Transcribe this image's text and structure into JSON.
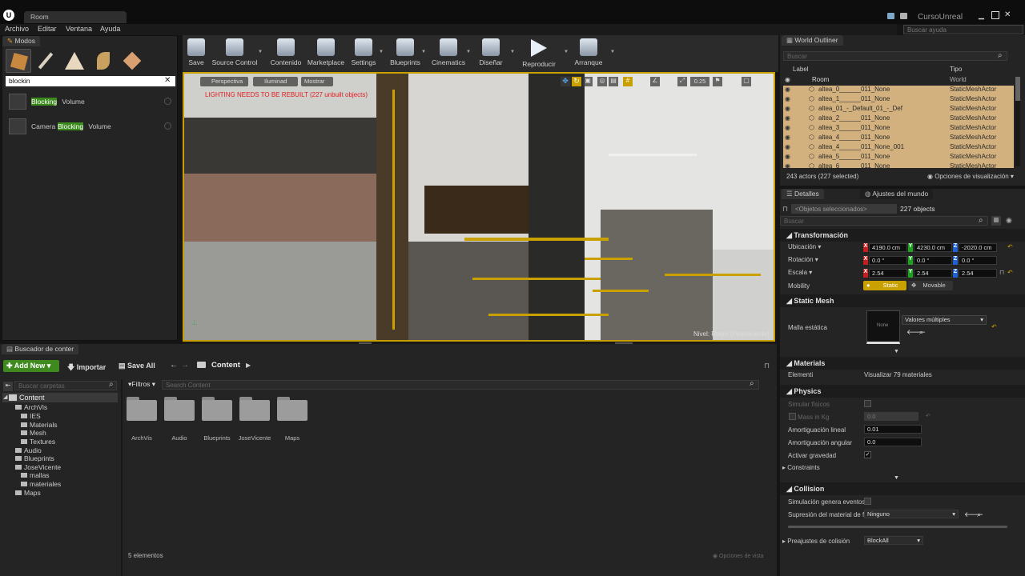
{
  "titlebar": {
    "tab_title": "Room",
    "project": "CursoUnreal",
    "help_search_placeholder": "Buscar ayuda"
  },
  "menu": {
    "items": [
      "Archivo",
      "Editar",
      "Ventana",
      "Ayuda"
    ]
  },
  "modes": {
    "tab_label": "Modos",
    "search_value": "blockin",
    "results": [
      {
        "prefix": "",
        "match": "Blocking",
        "suffix": " Volume"
      },
      {
        "prefix": "Camera ",
        "match": "Blocking",
        "suffix": " Volume"
      }
    ]
  },
  "toolbar": {
    "buttons": [
      "Save",
      "Source Control",
      "Contenido",
      "Marketplace",
      "Settings",
      "Blueprints",
      "Cinematics",
      "Diseñar",
      "Reproducir",
      "Arranque"
    ]
  },
  "viewport": {
    "perspective": "Perspectiva",
    "lighting": "Iluminad",
    "show": "Mostrar",
    "warning": "LIGHTING NEEDS TO BE REBUILT (227 unbuilt objects)",
    "level_label": "Nivel: Room (Permanente)",
    "grid_size": "0.25"
  },
  "outliner": {
    "tab_label": "World Outliner",
    "search_placeholder": "Buscar",
    "col_label": "Label",
    "col_type": "Tipo",
    "rows": [
      {
        "label": "Room",
        "type": "World"
      },
      {
        "label": "altea_0______011_None",
        "type": "StaticMeshActor"
      },
      {
        "label": "altea_1______011_None",
        "type": "StaticMeshActor"
      },
      {
        "label": "altea_01_-_Default_01_-_Def",
        "type": "StaticMeshActor"
      },
      {
        "label": "altea_2______011_None",
        "type": "StaticMeshActor"
      },
      {
        "label": "altea_3______011_None",
        "type": "StaticMeshActor"
      },
      {
        "label": "altea_4______011_None",
        "type": "StaticMeshActor"
      },
      {
        "label": "altea_4______011_None_001",
        "type": "StaticMeshActor"
      },
      {
        "label": "altea_5______011_None",
        "type": "StaticMeshActor"
      },
      {
        "label": "altea_6______011_None",
        "type": "StaticMeshActor"
      }
    ],
    "status": "243 actors (227 selected)",
    "view_options": "Opciones de visualización"
  },
  "details": {
    "tab_details": "Detalles",
    "tab_world": "Ajustes del mundo",
    "selected_placeholder": "<Objetos seleccionados>",
    "count": "227 objects",
    "search_placeholder": "Buscar",
    "transform": {
      "header": "Transformación",
      "location_label": "Ubicación",
      "rotation_label": "Rotación",
      "scale_label": "Escala",
      "location": [
        "4190.0 cm",
        "4230.0 cm",
        "-2020.0 cm"
      ],
      "rotation": [
        "0.0 °",
        "0.0 °",
        "0.0 °"
      ],
      "scale": [
        "2.54",
        "2.54",
        "2.54"
      ],
      "mobility_label": "Mobility",
      "mobility_static": "Static",
      "mobility_movable": "Movable"
    },
    "static_mesh": {
      "header": "Static Mesh",
      "label": "Malla estática",
      "thumb": "None",
      "value": "Valores múltiples"
    },
    "materials": {
      "header": "Materials",
      "label": "Elementi",
      "value": "Visualizar 79 materiales"
    },
    "physics": {
      "header": "Physics",
      "simulate": "Simular físicos",
      "mass": "Mass in Kg",
      "mass_value": "0.0",
      "linear_damping": "Amortiguación lineal",
      "linear_value": "0.01",
      "angular_damping": "Amortiguación angular",
      "angular_value": "0.0",
      "gravity": "Activar gravedad",
      "constraints": "Constraints"
    },
    "collision": {
      "header": "Collision",
      "events": "Simulación genera eventos",
      "material_override": "Supresión del material de f",
      "material_value": "Ninguno",
      "presets": "Preajustes de colisión",
      "presets_value": "BlockAll"
    }
  },
  "content_browser": {
    "tab_label": "Buscador de conter",
    "add_new": "Add New",
    "import": "Importar",
    "save_all": "Save All",
    "path": "Content",
    "folder_search_placeholder": "Buscar carpetas",
    "filters": "Filtros",
    "search_placeholder": "Search Content",
    "tree": [
      "Content",
      "ArchVis",
      "IES",
      "Materials",
      "Mesh",
      "Textures",
      "Audio",
      "Blueprints",
      "JoseVicente",
      "mallas",
      "materiales",
      "Maps"
    ],
    "folders": [
      "ArchVis",
      "Audio",
      "Blueprints",
      "JoseVicente",
      "Maps"
    ],
    "status": "5 elementos"
  },
  "colors": {
    "accent": "#c8a000",
    "highlight": "#3c8a1d",
    "selection": "#d2b17e"
  }
}
